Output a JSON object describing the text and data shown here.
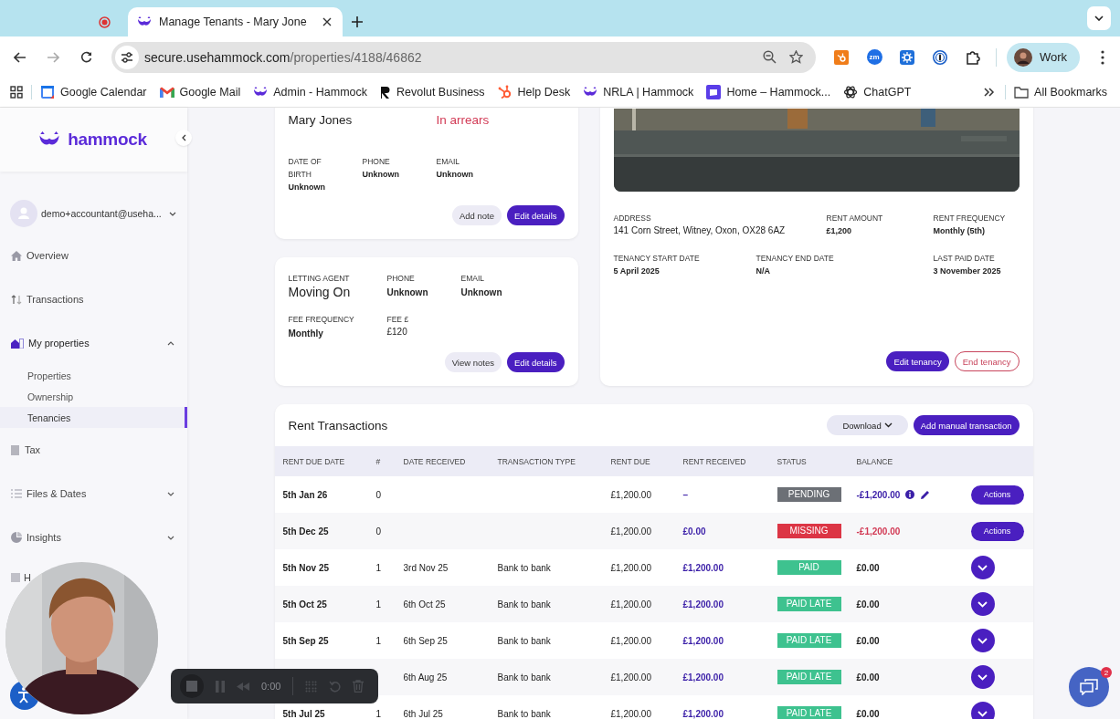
{
  "browser": {
    "tabs": [
      {
        "kind": "recording",
        "selected": false
      },
      {
        "kind": "page",
        "title": "Manage Tenants - Mary Jone",
        "selected": true
      }
    ],
    "url": {
      "domain": "secure.usehammock.com",
      "path": "/properties/4188/46862"
    },
    "extensions": [
      {
        "kind": "hubspot"
      },
      {
        "kind": "zoom",
        "label": "zm"
      },
      {
        "kind": "gear"
      },
      {
        "kind": "password"
      },
      {
        "kind": "puzzle"
      }
    ],
    "profile": "Work",
    "bookmarks": [
      {
        "label": "Google Calendar",
        "kind": "calendar"
      },
      {
        "label": "Google Mail",
        "kind": "mail"
      },
      {
        "label": "Admin - Hammock",
        "kind": "hammock"
      },
      {
        "label": "Revolut Business",
        "kind": "revolut"
      },
      {
        "label": "Help Desk",
        "kind": "hubspot"
      },
      {
        "label": "NRLA | Hammock",
        "kind": "hammock"
      },
      {
        "label": "Home – Hammock...",
        "kind": "square"
      },
      {
        "label": "ChatGPT",
        "kind": "chatgpt"
      }
    ],
    "all_bookmarks": "All Bookmarks"
  },
  "sidebar": {
    "brand": "hammock",
    "user": "demo+accountant@useha...",
    "items": [
      {
        "label": "Overview",
        "kind": "home"
      },
      {
        "label": "Transactions",
        "kind": "arrows"
      },
      {
        "label": "My properties",
        "kind": "building",
        "expanded": true,
        "children": [
          {
            "label": "Properties",
            "selected": false
          },
          {
            "label": "Ownership",
            "selected": false
          },
          {
            "label": "Tenancies",
            "selected": true
          }
        ]
      },
      {
        "label": "Tax",
        "kind": "tax"
      },
      {
        "label": "Files & Dates",
        "kind": "files",
        "expanded": false
      },
      {
        "label": "Insights",
        "kind": "pie",
        "expanded": false
      },
      {
        "label": "H",
        "kind": "help"
      }
    ]
  },
  "tenant": {
    "name": "Mary Jones",
    "status": "In arrears",
    "fields": [
      {
        "label": "DATE OF BIRTH",
        "value": "Unknown",
        "kind": "bold"
      },
      {
        "label": "PHONE",
        "value": "Unknown",
        "kind": "bold"
      },
      {
        "label": "EMAIL",
        "value": "Unknown",
        "kind": "bold"
      }
    ],
    "buttons": [
      {
        "label": "Add note",
        "kind": "secondary"
      },
      {
        "label": "Edit details",
        "kind": "primary"
      }
    ]
  },
  "agent": {
    "fields": [
      {
        "label": "LETTING AGENT",
        "value": "Moving On",
        "kind": "name"
      },
      {
        "label": "PHONE",
        "value": "Unknown",
        "kind": "bold"
      },
      {
        "label": "EMAIL",
        "value": "Unknown",
        "kind": "bold"
      },
      {
        "label": "FEE FREQUENCY",
        "value": "Monthly",
        "kind": "bold"
      },
      {
        "label": "FEE £",
        "value": "£120",
        "kind": "plain"
      }
    ],
    "buttons": [
      {
        "label": "View notes",
        "kind": "secondary"
      },
      {
        "label": "Edit details",
        "kind": "primary"
      }
    ]
  },
  "tenancy": {
    "fields": [
      {
        "label": "ADDRESS",
        "value": "141 Corn Street, Witney, Oxon, OX28 6AZ",
        "kind": "address"
      },
      {
        "label": "RENT AMOUNT",
        "value": "£1,200",
        "kind": "bold"
      },
      {
        "label": "RENT FREQUENCY",
        "value": "Monthly (5th)",
        "kind": "bold"
      },
      {
        "label": "TENANCY START DATE",
        "value": "5 April 2025",
        "kind": "bold"
      },
      {
        "label": "TENANCY END DATE",
        "value": "N/A",
        "kind": "bold"
      },
      {
        "label": "LAST PAID DATE",
        "value": "3 November 2025",
        "kind": "bold"
      }
    ],
    "buttons": [
      {
        "label": "Edit tenancy",
        "kind": "primary"
      },
      {
        "label": "End tenancy",
        "kind": "danger"
      }
    ]
  },
  "transactions": {
    "title": "Rent Transactions",
    "buttons": [
      {
        "label": "Download",
        "kind": "dropdown"
      },
      {
        "label": "Add manual transaction",
        "kind": "primary"
      }
    ],
    "columns": [
      "RENT DUE DATE",
      "#",
      "DATE RECEIVED",
      "TRANSACTION TYPE",
      "RENT DUE",
      "RENT RECEIVED",
      "STATUS",
      "BALANCE"
    ],
    "rows": [
      {
        "due_date": "5th Jan 26",
        "count": "0",
        "rent_due": "£1,200.00",
        "received": "–",
        "status": {
          "label": "PENDING",
          "kind": "pending"
        },
        "balance": {
          "value": "-£1,200.00",
          "kind": "pending"
        },
        "action": {
          "kind": "button",
          "label": "Actions"
        }
      },
      {
        "due_date": "5th Dec 25",
        "count": "0",
        "rent_due": "£1,200.00",
        "received": "£0.00",
        "status": {
          "label": "MISSING",
          "kind": "missing"
        },
        "balance": {
          "value": "-£1,200.00",
          "kind": "overdue"
        },
        "action": {
          "kind": "button",
          "label": "Actions"
        }
      },
      {
        "due_date": "5th Nov 25",
        "count": "1",
        "date_received": "3rd Nov 25",
        "type": "Bank to bank",
        "rent_due": "£1,200.00",
        "received": "£1,200.00",
        "status": {
          "label": "PAID",
          "kind": "paid"
        },
        "balance": {
          "value": "£0.00",
          "kind": "settled"
        },
        "action": {
          "kind": "expand"
        }
      },
      {
        "due_date": "5th Oct 25",
        "count": "1",
        "date_received": "6th Oct 25",
        "type": "Bank to bank",
        "rent_due": "£1,200.00",
        "received": "£1,200.00",
        "status": {
          "label": "PAID LATE",
          "kind": "paid"
        },
        "balance": {
          "value": "£0.00",
          "kind": "settled"
        },
        "action": {
          "kind": "expand"
        }
      },
      {
        "due_date": "5th Sep 25",
        "count": "1",
        "date_received": "6th Sep 25",
        "type": "Bank to bank",
        "rent_due": "£1,200.00",
        "received": "£1,200.00",
        "status": {
          "label": "PAID LATE",
          "kind": "paid"
        },
        "balance": {
          "value": "£0.00",
          "kind": "settled"
        },
        "action": {
          "kind": "expand"
        }
      },
      {
        "date_received": "6th Aug 25",
        "type": "Bank to bank",
        "rent_due": "£1,200.00",
        "received": "£1,200.00",
        "status": {
          "label": "PAID LATE",
          "kind": "paid"
        },
        "balance": {
          "value": "£0.00",
          "kind": "settled"
        },
        "action": {
          "kind": "expand"
        }
      },
      {
        "due_date": "5th Jul 25",
        "count": "1",
        "date_received": "6th Jul 25",
        "type": "Bank to bank",
        "rent_due": "£1,200.00",
        "received": "£1,200.00",
        "status": {
          "label": "PAID LATE",
          "kind": "paid"
        },
        "balance": {
          "value": "£0.00",
          "kind": "settled"
        },
        "action": {
          "kind": "expand"
        }
      }
    ]
  },
  "recorder": {
    "time": "0:00"
  },
  "chat": {
    "badge": "2"
  }
}
